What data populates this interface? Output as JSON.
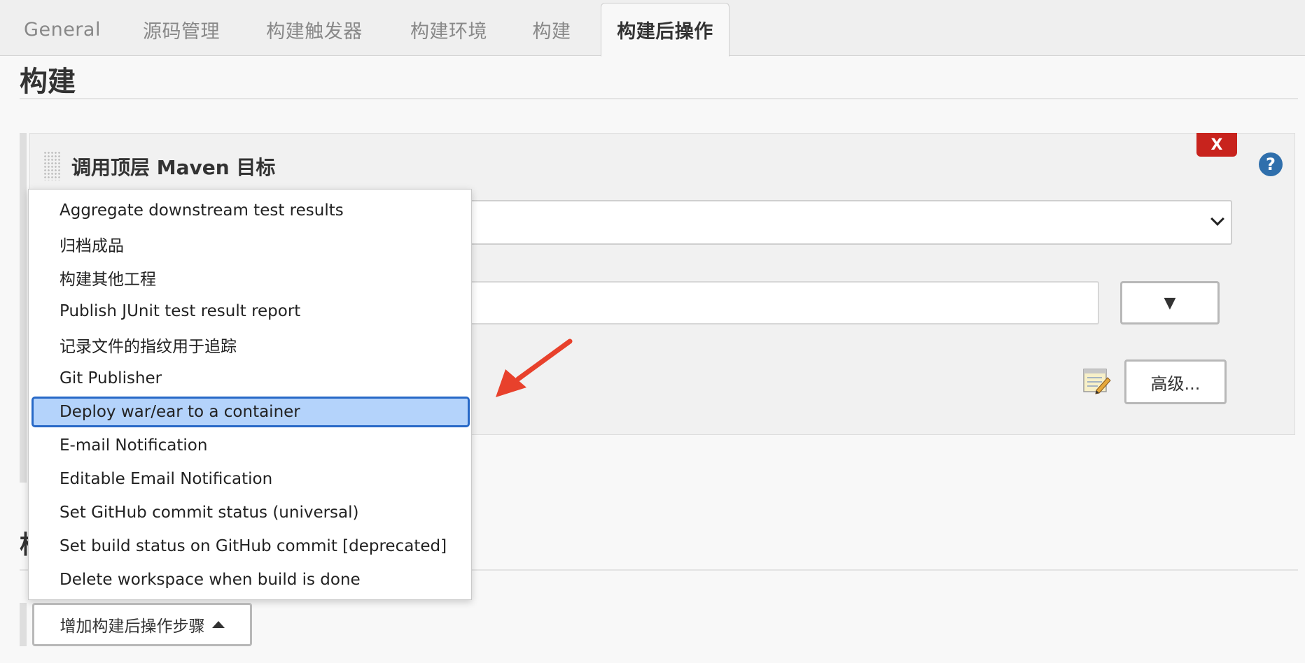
{
  "tabs": [
    {
      "label": "General"
    },
    {
      "label": "源码管理"
    },
    {
      "label": "构建触发器"
    },
    {
      "label": "构建环境"
    },
    {
      "label": "构建"
    },
    {
      "label": "构建后操作"
    }
  ],
  "active_tab": "构建后操作",
  "section": {
    "title": "构建",
    "next_title_partial": "构"
  },
  "build_step": {
    "title": "调用顶层 Maven 目标",
    "delete_label": "X",
    "help_label": "?",
    "expand_label": "▼",
    "advanced_label": "高级..."
  },
  "dropdown": {
    "items": [
      {
        "label": "Aggregate downstream test results"
      },
      {
        "label": "归档成品"
      },
      {
        "label": "构建其他工程"
      },
      {
        "label": "Publish JUnit test result report"
      },
      {
        "label": "记录文件的指纹用于追踪"
      },
      {
        "label": "Git Publisher"
      },
      {
        "label": "Deploy war/ear to a container"
      },
      {
        "label": "E-mail Notification"
      },
      {
        "label": "Editable Email Notification"
      },
      {
        "label": "Set GitHub commit status (universal)"
      },
      {
        "label": "Set build status on GitHub commit [deprecated]"
      },
      {
        "label": "Delete workspace when build is done"
      }
    ],
    "selected": "Deploy war/ear to a container"
  },
  "add_step_button": {
    "label": "增加构建后操作步骤"
  },
  "colors": {
    "delete": "#c8231d",
    "help": "#2f6fac",
    "selection_bg": "#b4d3fb",
    "selection_border": "#2869c7",
    "annotation_arrow": "#e8412c"
  },
  "icons": [
    "drag-handle-icon",
    "help-icon",
    "chevron-down-icon",
    "notepad-icon",
    "caret-up-icon",
    "annotation-arrow"
  ]
}
